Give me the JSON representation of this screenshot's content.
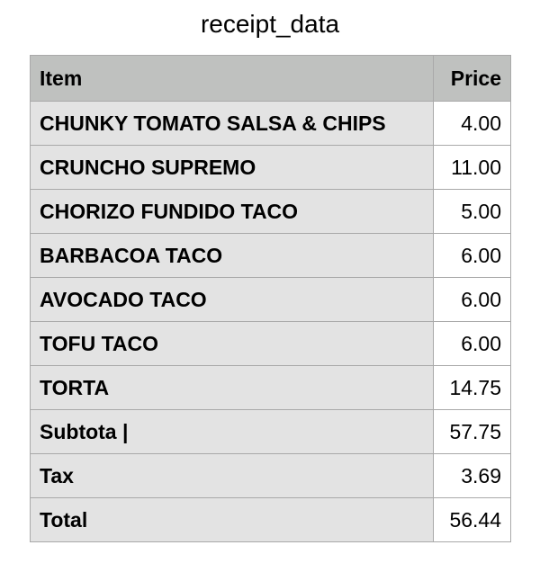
{
  "title": "receipt_data",
  "table": {
    "headers": [
      "Item",
      "Price"
    ],
    "rows": [
      {
        "item": "CHUNKY TOMATO SALSA & CHIPS",
        "price": "4.00"
      },
      {
        "item": "CRUNCHO SUPREMO",
        "price": "11.00"
      },
      {
        "item": "CHORIZO FUNDIDO TACO",
        "price": "5.00"
      },
      {
        "item": "BARBACOA TACO",
        "price": "6.00"
      },
      {
        "item": "AVOCADO TACO",
        "price": "6.00"
      },
      {
        "item": "TOFU TACO",
        "price": "6.00"
      },
      {
        "item": "TORTA",
        "price": "14.75"
      },
      {
        "item": "Subtota |",
        "price": "57.75"
      },
      {
        "item": "Tax",
        "price": "3.69"
      },
      {
        "item": "Total",
        "price": "56.44"
      }
    ]
  },
  "colors": {
    "header_bg": "#bfc1bf",
    "item_cell_bg": "#e3e3e3",
    "price_cell_bg": "#ffffff",
    "border": "#a9a9a9"
  }
}
